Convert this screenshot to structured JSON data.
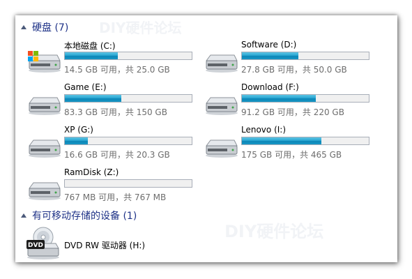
{
  "groups": {
    "hard_disks": {
      "label": "硬盘 (7)"
    },
    "removable": {
      "label": "有可移动存储的设备 (1)"
    }
  },
  "drives": [
    {
      "name": "本地磁盘 (C:)",
      "info": "14.5 GB 可用，共 25.0 GB",
      "used_fraction": 0.42,
      "system": true
    },
    {
      "name": "Software (D:)",
      "info": "27.8 GB 可用，共 50.0 GB",
      "used_fraction": 0.444
    },
    {
      "name": "Game (E:)",
      "info": "83.3 GB 可用，共 150 GB",
      "used_fraction": 0.445
    },
    {
      "name": "Download (F:)",
      "info": "91.2 GB 可用，共 220 GB",
      "used_fraction": 0.585
    },
    {
      "name": "XP (G:)",
      "info": "16.6 GB 可用，共 20.3 GB",
      "used_fraction": 0.182
    },
    {
      "name": "Lenovo (I:)",
      "info": "175 GB 可用，共 465 GB",
      "used_fraction": 0.624
    },
    {
      "name": "RamDisk (Z:)",
      "info": "767 MB 可用，共 767 MB",
      "used_fraction": 0.0
    }
  ],
  "dvd": {
    "name": "DVD RW 驱动器 (H:)",
    "badge": "DVD"
  },
  "colors": {
    "group_header": "#1e3287",
    "bar_fill": "#1897c6",
    "info_text": "#6d6d6d"
  }
}
